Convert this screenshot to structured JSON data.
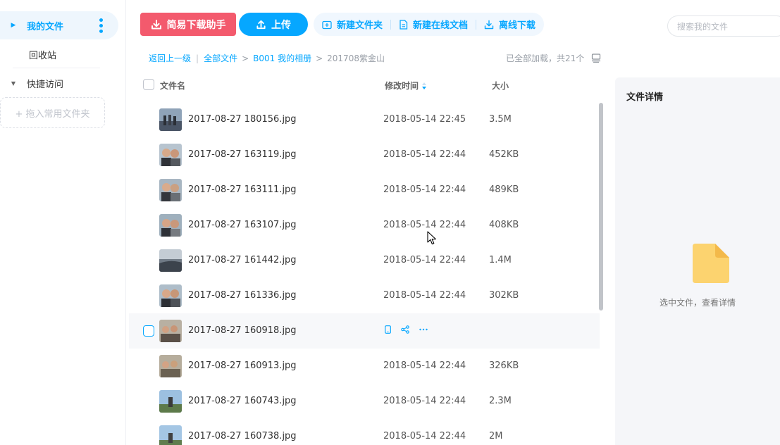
{
  "sidebar": {
    "my_files": "我的文件",
    "recycle": "回收站",
    "quick_access": "快捷访问",
    "drop_hint": "+ 拖入常用文件夹"
  },
  "toolbar": {
    "download_helper": "简易下载助手",
    "upload": "上传",
    "new_folder": "新建文件夹",
    "new_online_doc": "新建在线文档",
    "offline_download": "离线下载"
  },
  "search": {
    "placeholder": "搜索我的文件"
  },
  "breadcrumb": {
    "back": "返回上一级",
    "all": "全部文件",
    "album": "B001 我的相册",
    "current": "201708紫金山"
  },
  "loaded_status": "已全部加载，共21个",
  "columns": {
    "name": "文件名",
    "time": "修改时间",
    "size": "大小"
  },
  "files": [
    {
      "name": "2017-08-27 180156.jpg",
      "time": "2018-05-14 22:45",
      "size": "3.5M"
    },
    {
      "name": "2017-08-27 163119.jpg",
      "time": "2018-05-14 22:44",
      "size": "452KB"
    },
    {
      "name": "2017-08-27 163111.jpg",
      "time": "2018-05-14 22:44",
      "size": "489KB"
    },
    {
      "name": "2017-08-27 163107.jpg",
      "time": "2018-05-14 22:44",
      "size": "408KB"
    },
    {
      "name": "2017-08-27 161442.jpg",
      "time": "2018-05-14 22:44",
      "size": "1.4M"
    },
    {
      "name": "2017-08-27 161336.jpg",
      "time": "2018-05-14 22:44",
      "size": "302KB"
    },
    {
      "name": "2017-08-27 160918.jpg",
      "time": "",
      "size": ""
    },
    {
      "name": "2017-08-27 160913.jpg",
      "time": "2018-05-14 22:44",
      "size": "326KB"
    },
    {
      "name": "2017-08-27 160743.jpg",
      "time": "2018-05-14 22:44",
      "size": "2.3M"
    },
    {
      "name": "2017-08-27 160738.jpg",
      "time": "2018-05-14 22:44",
      "size": "2M"
    }
  ],
  "detail": {
    "title": "文件详情",
    "hint": "选中文件，查看详情"
  },
  "colors": {
    "accent": "#06a7ff",
    "download_button": "#f35a6d",
    "folder_icon": "#fcd36f"
  }
}
